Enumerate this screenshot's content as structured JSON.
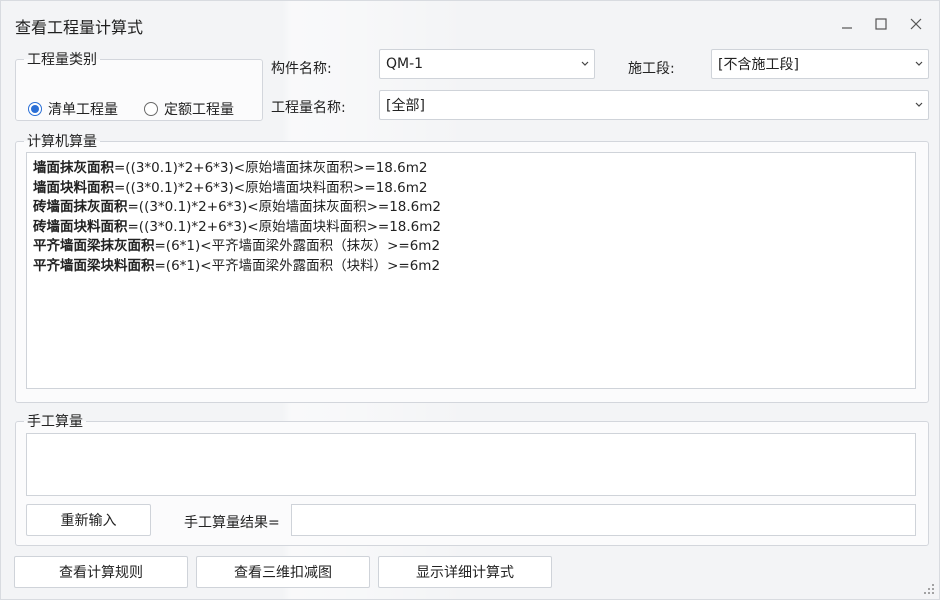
{
  "window": {
    "title": "查看工程量计算式"
  },
  "category": {
    "legend": "工程量类别",
    "options": [
      {
        "label": "清单工程量",
        "checked": true
      },
      {
        "label": "定额工程量",
        "checked": false
      }
    ]
  },
  "fields": {
    "component_label": "构件名称:",
    "component_value": "QM-1",
    "stage_label": "施工段:",
    "stage_value": "[不含施工段]",
    "qty_name_label": "工程量名称:",
    "qty_name_value": "[全部]"
  },
  "computer": {
    "legend": "计算机算量",
    "lines": [
      {
        "name": "墙面抹灰面积",
        "expr": "=((3*0.1)*2+6*3)<原始墙面抹灰面积>=18.6m2"
      },
      {
        "name": "墙面块料面积",
        "expr": "=((3*0.1)*2+6*3)<原始墙面块料面积>=18.6m2"
      },
      {
        "name": "砖墙面抹灰面积",
        "expr": "=((3*0.1)*2+6*3)<原始墙面抹灰面积>=18.6m2"
      },
      {
        "name": "砖墙面块料面积",
        "expr": "=((3*0.1)*2+6*3)<原始墙面块料面积>=18.6m2"
      },
      {
        "name": "平齐墙面梁抹灰面积",
        "expr": "=(6*1)<平齐墙面梁外露面积（抹灰）>=6m2"
      },
      {
        "name": "平齐墙面梁块料面积",
        "expr": "=(6*1)<平齐墙面梁外露面积（块料）>=6m2"
      }
    ]
  },
  "manual": {
    "legend": "手工算量",
    "reenter_label": "重新输入",
    "result_label": "手工算量结果=",
    "result_value": ""
  },
  "bottom": {
    "rules_label": "查看计算规则",
    "view3d_label": "查看三维扣减图",
    "detail_label": "显示详细计算式"
  },
  "colors": {
    "accent": "#2b6fd6"
  },
  "icons": {
    "minimize": "minimize-icon",
    "maximize": "maximize-icon",
    "close": "close-icon",
    "dropdown": "chevron-down-icon",
    "resize": "resize-grip-icon"
  }
}
